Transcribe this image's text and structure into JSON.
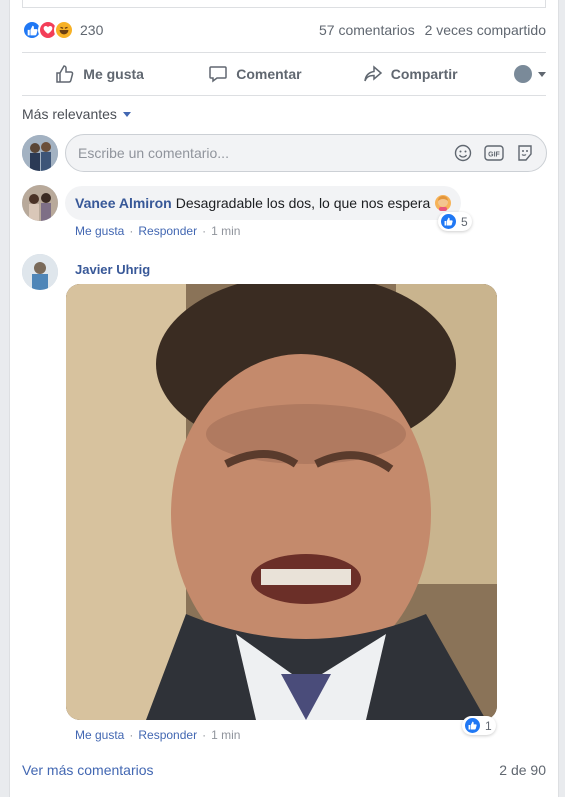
{
  "colors": {
    "link": "#385898",
    "accent": "#4267b2",
    "like": "#2078f4",
    "love": "#f33e58",
    "haha": "#f7b125"
  },
  "reactions": {
    "icons": [
      "like-icon",
      "love-icon",
      "haha-icon"
    ],
    "count": "230"
  },
  "stats": {
    "comments": "57 comentarios",
    "shares": "2 veces compartido"
  },
  "actions": {
    "like": "Me gusta",
    "comment": "Comentar",
    "share": "Compartir"
  },
  "sort": {
    "label": "Más relevantes"
  },
  "composer": {
    "placeholder": "Escribe un comentario..."
  },
  "comments": [
    {
      "author": "Vanee Almiron",
      "text": "Desagradable los dos, lo que nos espera",
      "reaction_count": "5",
      "like": "Me gusta",
      "reply": "Responder",
      "time": "1 min"
    },
    {
      "author": "Javier Uhrig",
      "media": "gif",
      "reaction_count": "1",
      "like": "Me gusta",
      "reply": "Responder",
      "time": "1 min"
    }
  ],
  "footer": {
    "more": "Ver más comentarios",
    "count": "2 de 90"
  }
}
